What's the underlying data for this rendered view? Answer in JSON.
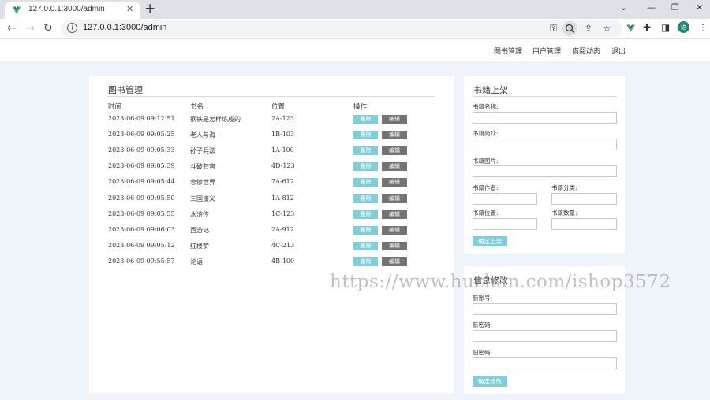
{
  "browser": {
    "tab_title": "127.0.0.1:3000/admin",
    "url": "127.0.0.1:3000/admin",
    "avatar_letter": "语",
    "accent": "#1a8a75"
  },
  "nav": {
    "items": [
      "图书管理",
      "用户管理",
      "借阅动态",
      "退出"
    ]
  },
  "books_panel": {
    "title": "图书管理",
    "headers": [
      "时间",
      "书名",
      "位置",
      "操作"
    ],
    "delete_label": "删除",
    "edit_label": "编辑",
    "rows": [
      {
        "time": "2023-06-09 09:12:51",
        "name": "钢铁是怎样炼成的",
        "location": "2A-123"
      },
      {
        "time": "2023-06-09 09:05:25",
        "name": "老人与海",
        "location": "1B-103"
      },
      {
        "time": "2023-06-09 09:05:33",
        "name": "孙子兵法",
        "location": "1A-100"
      },
      {
        "time": "2023-06-09 09:05:39",
        "name": "斗破苍穹",
        "location": "4D-123"
      },
      {
        "time": "2023-06-09 09:05:44",
        "name": "悲惨世界",
        "location": "7A-612"
      },
      {
        "time": "2023-06-09 09:05:50",
        "name": "三国演义",
        "location": "1A-812"
      },
      {
        "time": "2023-06-09 09:05:55",
        "name": "水浒传",
        "location": "1C-123"
      },
      {
        "time": "2023-06-09 09:06:03",
        "name": "西游记",
        "location": "2A-912"
      },
      {
        "time": "2023-06-09 09:05:12",
        "name": "红楼梦",
        "location": "4C-213"
      },
      {
        "time": "2023-06-09 09:55:57",
        "name": "论语",
        "location": "4B-100"
      }
    ]
  },
  "add_book": {
    "title": "书籍上架",
    "name_label": "书籍名称:",
    "intro_label": "书籍简介:",
    "image_label": "书籍图片:",
    "author_label": "书籍作者:",
    "category_label": "书籍分类:",
    "location_label": "书籍位置:",
    "count_label": "书籍数量:",
    "submit_label": "确定上架"
  },
  "change_info": {
    "title": "信息修改",
    "new_account_label": "新账号:",
    "new_password_label": "新密码:",
    "old_password_label": "旧密码:",
    "submit_label": "确定修改"
  },
  "watermark": "https://www.huzhan.com/ishop3572"
}
